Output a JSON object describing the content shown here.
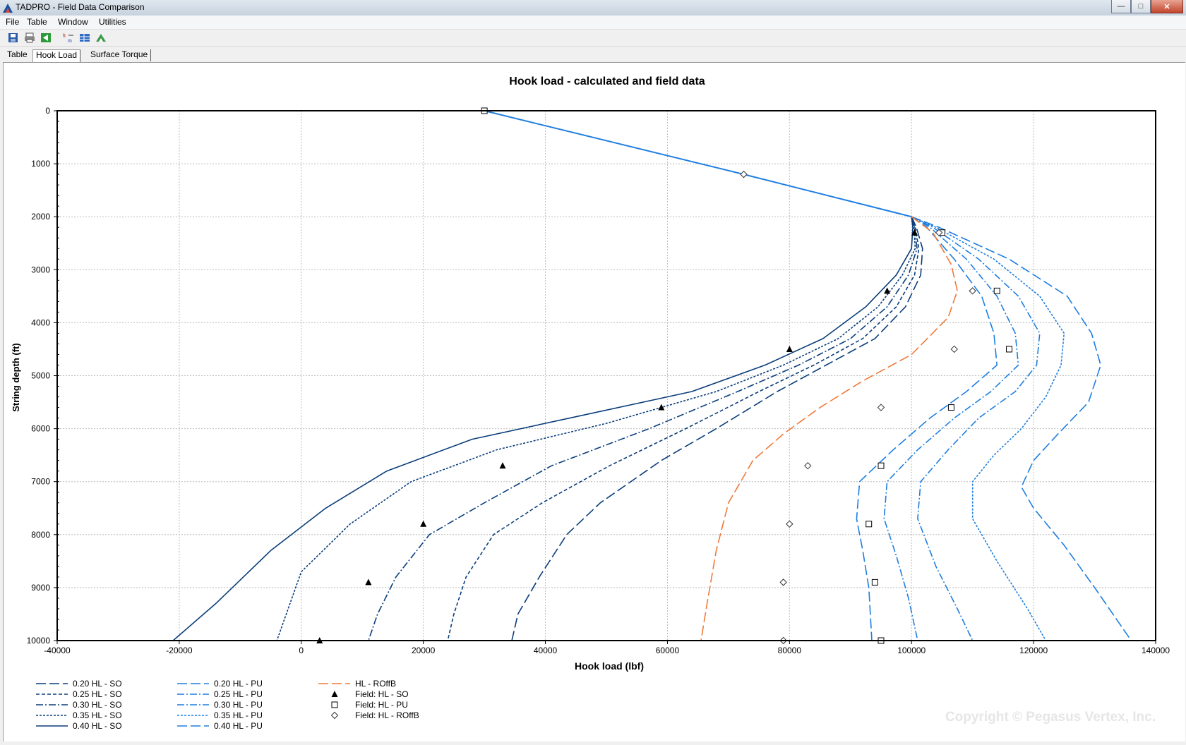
{
  "window": {
    "title": "TADPRO - Field Data Comparison"
  },
  "menu": {
    "items": [
      "File",
      "Table",
      "Window",
      "Utilities"
    ]
  },
  "toolbar": {
    "icons": [
      "save-icon",
      "print-icon",
      "back-icon",
      "units-icon",
      "table-icon",
      "export-icon"
    ]
  },
  "tabs": [
    "Table",
    "Hook Load",
    "Surface Torque"
  ],
  "active_tab": "Hook Load",
  "copyright": "Copyright © Pegasus Vertex, Inc.",
  "colors": {
    "so": "#0a3d7a",
    "pu": "#1e7ee0",
    "roffb": "#f07a3a",
    "field": "#000000"
  },
  "chart_data": {
    "type": "line",
    "title": "Hook load - calculated and field data",
    "xlabel": "Hook load (lbf)",
    "ylabel": "String depth (ft)",
    "xlim": [
      -40000,
      140000
    ],
    "ylim": [
      10000,
      0
    ],
    "y_inverted": true,
    "x_ticks": [
      -40000,
      -20000,
      0,
      20000,
      40000,
      60000,
      80000,
      100000,
      120000,
      140000
    ],
    "y_ticks": [
      0,
      1000,
      2000,
      3000,
      4000,
      5000,
      6000,
      7000,
      8000,
      9000,
      10000
    ],
    "grid": true,
    "legend_position": "bottom",
    "common_top": [
      [
        30000,
        0
      ],
      [
        72500,
        1200
      ],
      [
        100000,
        2000
      ]
    ],
    "series": [
      {
        "name": "0.20 HL - SO",
        "group": "so",
        "dash": "long",
        "points": [
          [
            100000,
            2000
          ],
          [
            100800,
            2200
          ],
          [
            101800,
            2600
          ],
          [
            101500,
            3100
          ],
          [
            99000,
            3700
          ],
          [
            94000,
            4300
          ],
          [
            86000,
            4800
          ],
          [
            78000,
            5300
          ],
          [
            68000,
            6000
          ],
          [
            59000,
            6600
          ],
          [
            49000,
            7400
          ],
          [
            43500,
            8000
          ],
          [
            39000,
            8800
          ],
          [
            35500,
            9500
          ],
          [
            34500,
            10000
          ]
        ]
      },
      {
        "name": "0.25 HL - SO",
        "group": "so",
        "dash": "short",
        "points": [
          [
            100000,
            2000
          ],
          [
            100600,
            2200
          ],
          [
            101200,
            2600
          ],
          [
            100500,
            3100
          ],
          [
            97500,
            3700
          ],
          [
            92000,
            4300
          ],
          [
            84000,
            4800
          ],
          [
            75000,
            5300
          ],
          [
            63000,
            6000
          ],
          [
            50500,
            6700
          ],
          [
            39500,
            7400
          ],
          [
            31500,
            8000
          ],
          [
            27000,
            8800
          ],
          [
            25000,
            9500
          ],
          [
            24000,
            10000
          ]
        ]
      },
      {
        "name": "0.30 HL - SO",
        "group": "so",
        "dash": "dashdot",
        "points": [
          [
            100000,
            2000
          ],
          [
            100500,
            2200
          ],
          [
            100900,
            2600
          ],
          [
            99500,
            3100
          ],
          [
            96000,
            3700
          ],
          [
            90000,
            4300
          ],
          [
            81500,
            4800
          ],
          [
            71500,
            5300
          ],
          [
            57000,
            6000
          ],
          [
            41000,
            6700
          ],
          [
            30000,
            7400
          ],
          [
            21000,
            8000
          ],
          [
            15500,
            8800
          ],
          [
            12500,
            9500
          ],
          [
            11000,
            10000
          ]
        ]
      },
      {
        "name": "0.35 HL - SO",
        "group": "so",
        "dash": "dot",
        "points": [
          [
            100000,
            2000
          ],
          [
            100400,
            2200
          ],
          [
            100600,
            2600
          ],
          [
            98500,
            3100
          ],
          [
            94500,
            3700
          ],
          [
            88000,
            4300
          ],
          [
            79000,
            4800
          ],
          [
            68000,
            5300
          ],
          [
            50000,
            5900
          ],
          [
            32000,
            6400
          ],
          [
            18000,
            7000
          ],
          [
            8000,
            7800
          ],
          [
            0,
            8700
          ],
          [
            -4000,
            10000
          ]
        ]
      },
      {
        "name": "0.40 HL - SO",
        "group": "so",
        "dash": "solid",
        "points": [
          [
            100000,
            2000
          ],
          [
            100200,
            2200
          ],
          [
            100000,
            2600
          ],
          [
            97500,
            3100
          ],
          [
            92500,
            3700
          ],
          [
            85500,
            4300
          ],
          [
            76000,
            4800
          ],
          [
            64000,
            5300
          ],
          [
            46000,
            5750
          ],
          [
            28000,
            6200
          ],
          [
            14000,
            6800
          ],
          [
            4000,
            7500
          ],
          [
            -5000,
            8300
          ],
          [
            -14000,
            9300
          ],
          [
            -21000,
            10000
          ]
        ]
      },
      {
        "name": "0.20 HL - PU",
        "group": "pu",
        "dash": "long",
        "points": [
          [
            100000,
            2000
          ],
          [
            102500,
            2200
          ],
          [
            107000,
            2800
          ],
          [
            111500,
            3500
          ],
          [
            113500,
            4200
          ],
          [
            114000,
            4800
          ],
          [
            109000,
            5300
          ],
          [
            103000,
            5800
          ],
          [
            97000,
            6400
          ],
          [
            91500,
            7000
          ],
          [
            91000,
            7700
          ],
          [
            92000,
            8300
          ],
          [
            93000,
            9000
          ],
          [
            93500,
            10000
          ]
        ]
      },
      {
        "name": "0.25 HL - PU",
        "group": "pu",
        "dash": "dashdot",
        "points": [
          [
            100000,
            2000
          ],
          [
            103000,
            2200
          ],
          [
            109000,
            2800
          ],
          [
            114000,
            3500
          ],
          [
            117000,
            4200
          ],
          [
            117500,
            4800
          ],
          [
            113000,
            5300
          ],
          [
            107000,
            5800
          ],
          [
            101000,
            6400
          ],
          [
            96000,
            7000
          ],
          [
            95500,
            7700
          ],
          [
            97500,
            8400
          ],
          [
            99500,
            9200
          ],
          [
            101000,
            10000
          ]
        ]
      },
      {
        "name": "0.30 HL - PU",
        "group": "pu",
        "dash": "dashdot",
        "points": [
          [
            100000,
            2000
          ],
          [
            103500,
            2200
          ],
          [
            111000,
            2800
          ],
          [
            117500,
            3500
          ],
          [
            121000,
            4200
          ],
          [
            120500,
            4800
          ],
          [
            117000,
            5300
          ],
          [
            111000,
            5800
          ],
          [
            106000,
            6400
          ],
          [
            101500,
            7000
          ],
          [
            101000,
            7700
          ],
          [
            104000,
            8600
          ],
          [
            107500,
            9400
          ],
          [
            110000,
            10000
          ]
        ]
      },
      {
        "name": "0.35 HL - PU",
        "group": "pu",
        "dash": "dot",
        "points": [
          [
            100000,
            2000
          ],
          [
            104000,
            2200
          ],
          [
            113500,
            2800
          ],
          [
            121000,
            3500
          ],
          [
            125000,
            4200
          ],
          [
            124500,
            4800
          ],
          [
            122000,
            5400
          ],
          [
            118000,
            6000
          ],
          [
            113500,
            6500
          ],
          [
            110000,
            7000
          ],
          [
            110000,
            7700
          ],
          [
            114000,
            8500
          ],
          [
            119000,
            9400
          ],
          [
            122000,
            10000
          ]
        ]
      },
      {
        "name": "0.40 HL - PU",
        "group": "pu",
        "dash": "long",
        "points": [
          [
            100000,
            2000
          ],
          [
            104500,
            2200
          ],
          [
            116000,
            2800
          ],
          [
            125500,
            3500
          ],
          [
            129500,
            4200
          ],
          [
            131000,
            4800
          ],
          [
            129000,
            5500
          ],
          [
            124000,
            6100
          ],
          [
            120000,
            6600
          ],
          [
            118000,
            7100
          ],
          [
            120000,
            7500
          ],
          [
            125000,
            8200
          ],
          [
            130000,
            9000
          ],
          [
            136000,
            10000
          ]
        ]
      },
      {
        "name": "HL - ROffB",
        "group": "roffb",
        "dash": "long",
        "points": [
          [
            100000,
            2000
          ],
          [
            103500,
            2300
          ],
          [
            106500,
            2900
          ],
          [
            107500,
            3400
          ],
          [
            106000,
            3900
          ],
          [
            100000,
            4600
          ],
          [
            92000,
            5100
          ],
          [
            85000,
            5600
          ],
          [
            79000,
            6100
          ],
          [
            74000,
            6600
          ],
          [
            70000,
            7400
          ],
          [
            68000,
            8300
          ],
          [
            66500,
            9300
          ],
          [
            65500,
            10000
          ]
        ]
      }
    ],
    "field_so": [
      [
        100500,
        2300
      ],
      [
        96000,
        3400
      ],
      [
        80000,
        4500
      ],
      [
        59000,
        5600
      ],
      [
        33000,
        6700
      ],
      [
        20000,
        7800
      ],
      [
        11000,
        8900
      ],
      [
        3000,
        10000
      ]
    ],
    "field_pu": [
      [
        30000,
        0
      ],
      [
        105000,
        2300
      ],
      [
        114000,
        3400
      ],
      [
        116000,
        4500
      ],
      [
        106500,
        5600
      ],
      [
        95000,
        6700
      ],
      [
        93000,
        7800
      ],
      [
        94000,
        8900
      ],
      [
        95000,
        10000
      ]
    ],
    "field_roffb": [
      [
        72500,
        1200
      ],
      [
        104500,
        2300
      ],
      [
        110000,
        3400
      ],
      [
        107000,
        4500
      ],
      [
        95000,
        5600
      ],
      [
        83000,
        6700
      ],
      [
        80000,
        7800
      ],
      [
        79000,
        8900
      ],
      [
        79000,
        10000
      ]
    ],
    "legend_field": [
      "Field: HL - SO",
      "Field: HL - PU",
      "Field: HL - ROffB"
    ]
  }
}
